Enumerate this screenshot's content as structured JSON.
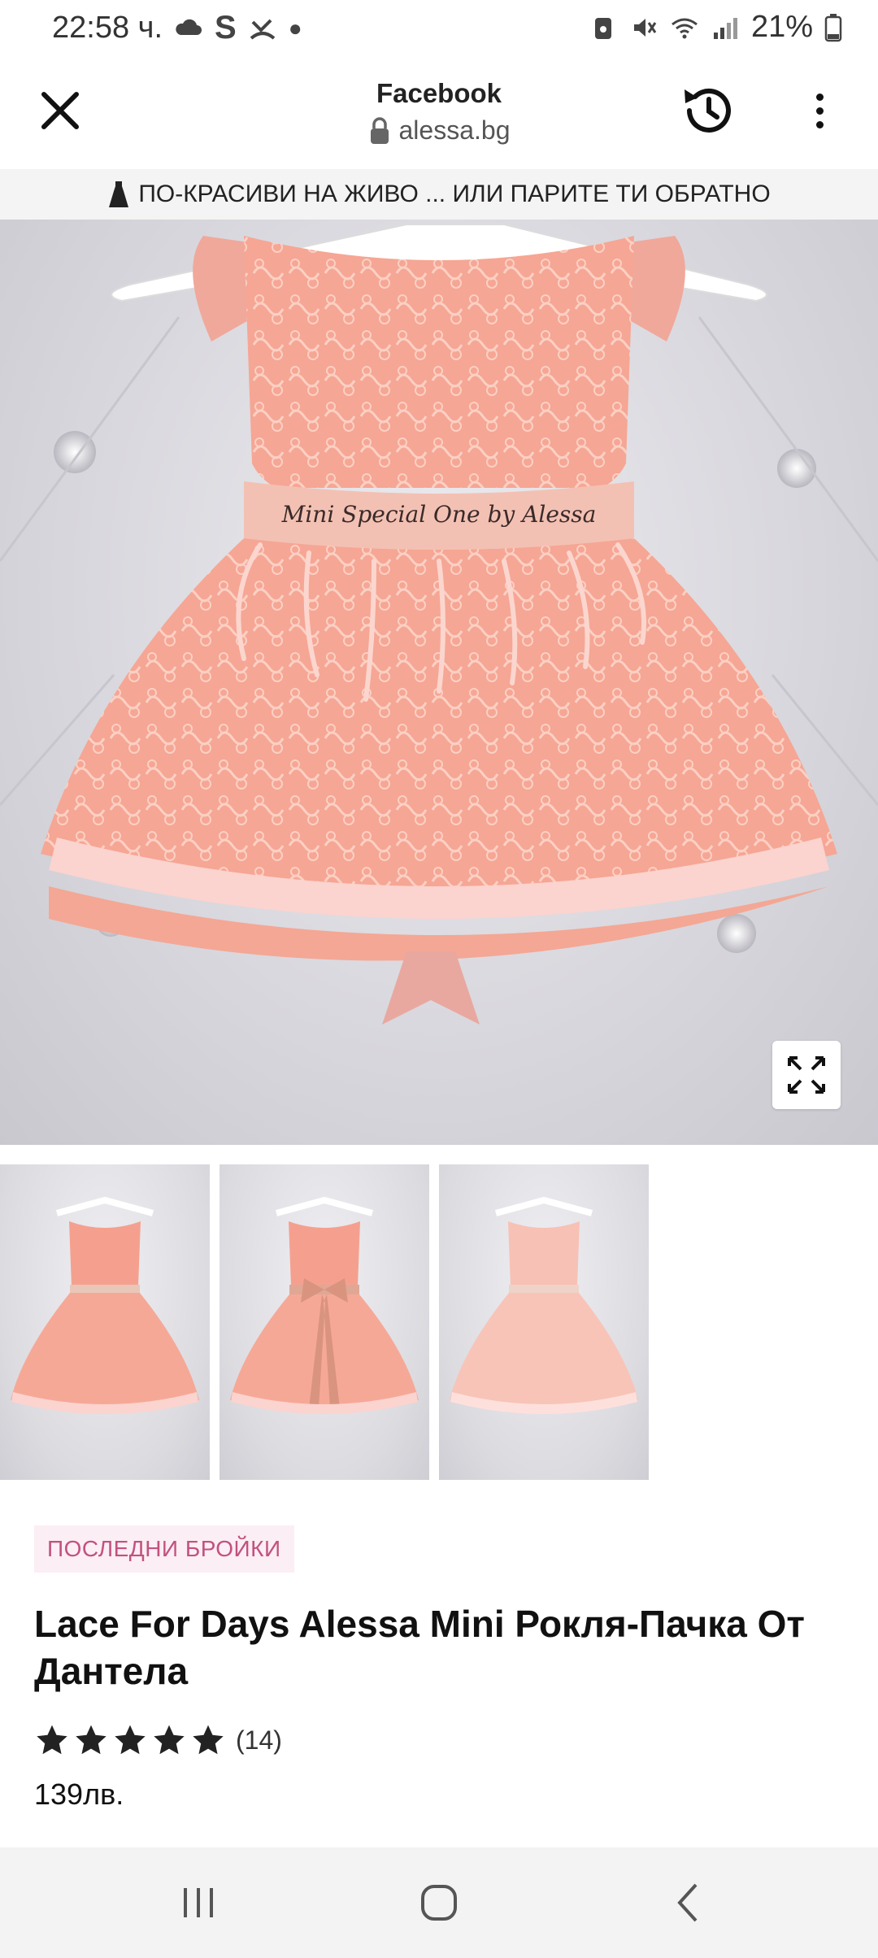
{
  "status_bar": {
    "time": "22:58 ч.",
    "battery": "21%"
  },
  "browser": {
    "title": "Facebook",
    "url": "alessa.bg"
  },
  "promo": {
    "text": "ПО-КРАСИВИ НА ЖИВО ... ИЛИ ПАРИТЕ ТИ ОБРАТНО"
  },
  "product": {
    "badge": "ПОСЛЕДНИ БРОЙКИ",
    "title": "Lace For Days Alessa Mini Рокля-Пачка От Дантела",
    "rating": 5,
    "review_count": "(14)",
    "price": "139лв.",
    "belt_text": "Mini Special One by Alessa"
  },
  "colors": {
    "dress": "#f7a996",
    "dress_dark": "#ef8f7d",
    "ribbon": "#fbd3cf",
    "badge_bg": "#fbeef4",
    "badge_text": "#c2527f"
  }
}
